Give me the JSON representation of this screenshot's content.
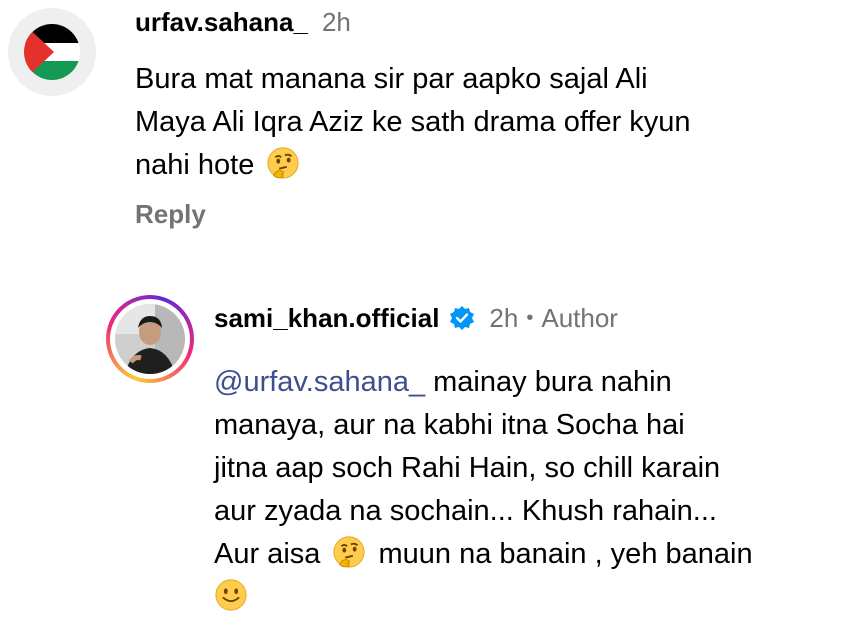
{
  "comments": [
    {
      "username": "urfav.sahana_",
      "time": "2h",
      "avatar_icon": "palestine-flag-icon",
      "lines": [
        "Bura mat manana sir par aapko sajal Ali",
        "Maya Ali Iqra Aziz ke sath drama offer kyun",
        "nahi hote"
      ],
      "emoji": "thinking-face-icon",
      "reply_label": "Reply"
    },
    {
      "username": "sami_khan.official",
      "verified": true,
      "time": "2h",
      "separator": "•",
      "author_label": "Author",
      "mention": "@urfav.sahana_",
      "line1_rest": " mainay bura nahin",
      "lines": [
        "manaya, aur na kabhi itna Socha hai",
        "jitna aap soch Rahi Hain, so chill karain",
        "aur zyada na sochain... Khush rahain..."
      ],
      "line5_start": "Aur aisa",
      "line5_end": "muun na banain , yeh banain",
      "emoji_thinking": "thinking-face-icon",
      "emoji_smile": "slightly-smiling-face-icon"
    }
  ],
  "colors": {
    "secondary_text": "#737373",
    "mention": "#3d4f8f",
    "verified_blue": "#0095f6"
  }
}
